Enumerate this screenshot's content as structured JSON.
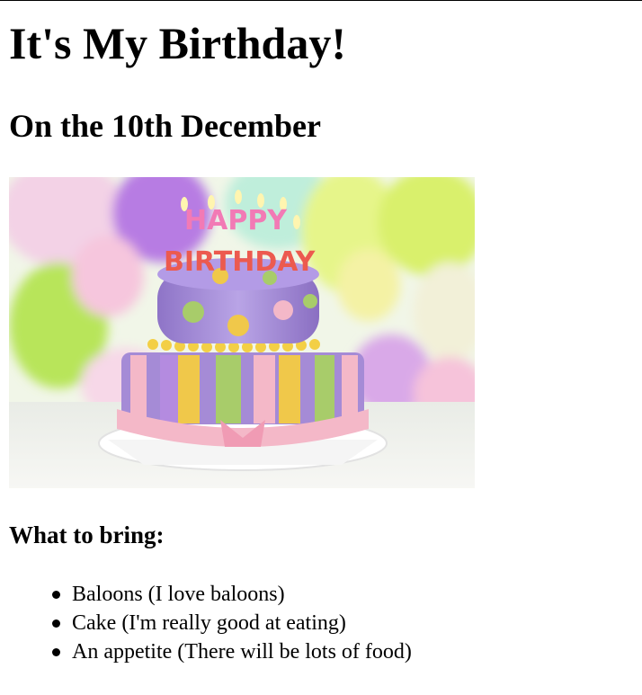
{
  "heading": "It's My Birthday!",
  "subheading": "On the 10th December",
  "image": {
    "name": "birthday-cake-photo",
    "candle_text": "HAPPY BIRTHDAY",
    "candle_line1": "HAPPY",
    "candle_line2": "BIRTHDAY"
  },
  "bring_heading": "What to bring:",
  "items": [
    "Baloons (I love baloons)",
    "Cake (I'm really good at eating)",
    "An appetite (There will be lots of food)"
  ],
  "colors": {
    "cake_purple": "#a58bd6",
    "stripe_yellow": "#f0c84a",
    "stripe_green": "#a8cc6a",
    "ribbon_pink": "#f4b8c8"
  }
}
